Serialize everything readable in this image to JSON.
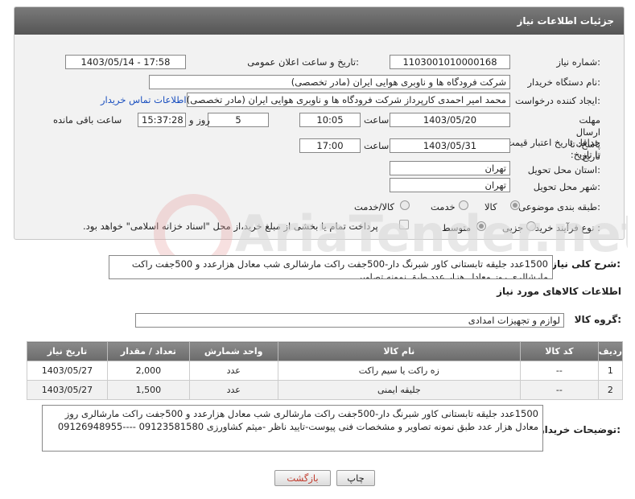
{
  "header": {
    "title": "جزئیات اطلاعات نیاز"
  },
  "fields": {
    "need_number_label": "شماره نیاز:",
    "need_number": "1103001010000168",
    "announce_label": "تاریخ و ساعت اعلان عمومی:",
    "announce_value": "1403/05/14 - 17:58",
    "buyer_org_label": "نام دستگاه خریدار:",
    "buyer_org": "شرکت فرودگاه ها و ناوبری هوایی ایران (مادر تخصصی)",
    "requester_label": "ایجاد کننده درخواست:",
    "requester": "محمد امیر احمدی کارپرداز شرکت فرودگاه ها و ناوبری هوایی ایران (مادر تخصصی)",
    "buyer_contact_link": "اطلاعات تماس خریدار",
    "deadline_label": "مهلت ارسال پاسخ: تا تاریخ:",
    "deadline_date": "1403/05/20",
    "time_label": "ساعت",
    "deadline_time": "10:05",
    "days_value": "5",
    "days_label": "روز و",
    "remaining_time": "15:37:28",
    "remaining_label": "ساعت باقی مانده",
    "price_validity_label": "حداقل تاریخ اعتبار قیمت: تا تاریخ:",
    "price_validity_date": "1403/05/31",
    "price_validity_time": "17:00",
    "province_label": "استان محل تحویل:",
    "province": "تهران",
    "city_label": "شهر محل تحویل:",
    "city": "تهران",
    "category_label": "طبقه بندی موضوعی:",
    "category_options": [
      "کالا",
      "خدمت",
      "کالا/خدمت"
    ],
    "category_selected": "کالا",
    "purchase_type_label": "نوع فرآیند خرید :",
    "purchase_options": [
      "جزیی",
      "متوسط"
    ],
    "purchase_selected": "متوسط",
    "payment_note": "پرداخت تمام یا بخشی از مبلغ خرید،از محل \"اسناد خزانه اسلامی\" خواهد بود."
  },
  "general_description": {
    "label": "شرح کلی نیاز:",
    "text": "1500عدد جلیقه تابستانی کاور شبرنگ دار-500جفت راکت مارشالری شب معادل هزارعدد و 500جفت راکت مارشالری روز معادل هزار عدد طبق نمونه تصاویر"
  },
  "goods_info": {
    "title": "اطلاعات کالاهای مورد نیاز",
    "group_label": "گروه کالا:",
    "group_value": "لوازم و تجهیزات امدادی"
  },
  "table": {
    "headers": [
      "ردیف",
      "کد کالا",
      "نام کالا",
      "واحد شمارش",
      "تعداد / مقدار",
      "تاریخ نیاز"
    ],
    "rows": [
      [
        "1",
        "--",
        "زه راکت یا سیم راکت",
        "عدد",
        "2,000",
        "1403/05/27"
      ],
      [
        "2",
        "--",
        "جلیقه ایمنی",
        "عدد",
        "1,500",
        "1403/05/27"
      ]
    ]
  },
  "buyer_notes": {
    "label": "توضیحات خریدار:",
    "text": "1500عدد جلیقه تابستانی کاور شبرنگ دار-500جفت راکت مارشالری شب معادل هزارعدد و 500جفت راکت مارشالری روز معادل هزار عدد طبق نمونه تصاویر و مشخصات فنی پیوست-تایید ناظر -میثم کشاورزی 09123581580 ----09126948955"
  },
  "buttons": {
    "print": "چاپ",
    "back": "بازگشت"
  },
  "watermark_text": "AriaTender.net",
  "colors": {
    "header": "#666666",
    "link": "#1a4fbf",
    "back_button_text": "#c0392b"
  }
}
